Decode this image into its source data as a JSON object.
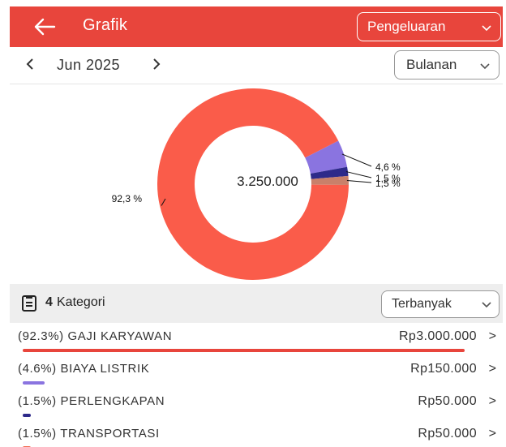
{
  "header": {
    "title": "Grafik",
    "type_select": "Pengeluaran"
  },
  "period": {
    "month": "Jun 2025",
    "mode_select": "Bulanan"
  },
  "chart_data": {
    "type": "pie",
    "center_label": "3.250.000",
    "slices": [
      {
        "name": "GAJI KARYAWAN",
        "percent": 92.3,
        "label": "92,3 %",
        "color": "#fa5c4a"
      },
      {
        "name": "BIAYA LISTRIK",
        "percent": 4.6,
        "label": "4,6 %",
        "color": "#8a74e0"
      },
      {
        "name": "PERLENGKAPAN",
        "percent": 1.5,
        "label": "1,5 %",
        "color": "#2d2a8a"
      },
      {
        "name": "TRANSPORTASI",
        "percent": 1.5,
        "label": "1,5 %",
        "color": "#c9806a"
      }
    ]
  },
  "categories": {
    "count": "4",
    "label": "Kategori",
    "sort_select": "Terbanyak",
    "items": [
      {
        "name": "(92.3%) GAJI KARYAWAN",
        "amount": "Rp3.000.000",
        "share": 0.923,
        "color": "#e8453c"
      },
      {
        "name": "(4.6%) BIAYA LISTRIK",
        "amount": "Rp150.000",
        "share": 0.046,
        "color": "#8a74e0"
      },
      {
        "name": "(1.5%) PERLENGKAPAN",
        "amount": "Rp50.000",
        "share": 0.015,
        "color": "#2d2a8a"
      },
      {
        "name": "(1.5%) TRANSPORTASI",
        "amount": "Rp50.000",
        "share": 0.015,
        "color": "#f26b50"
      }
    ]
  }
}
